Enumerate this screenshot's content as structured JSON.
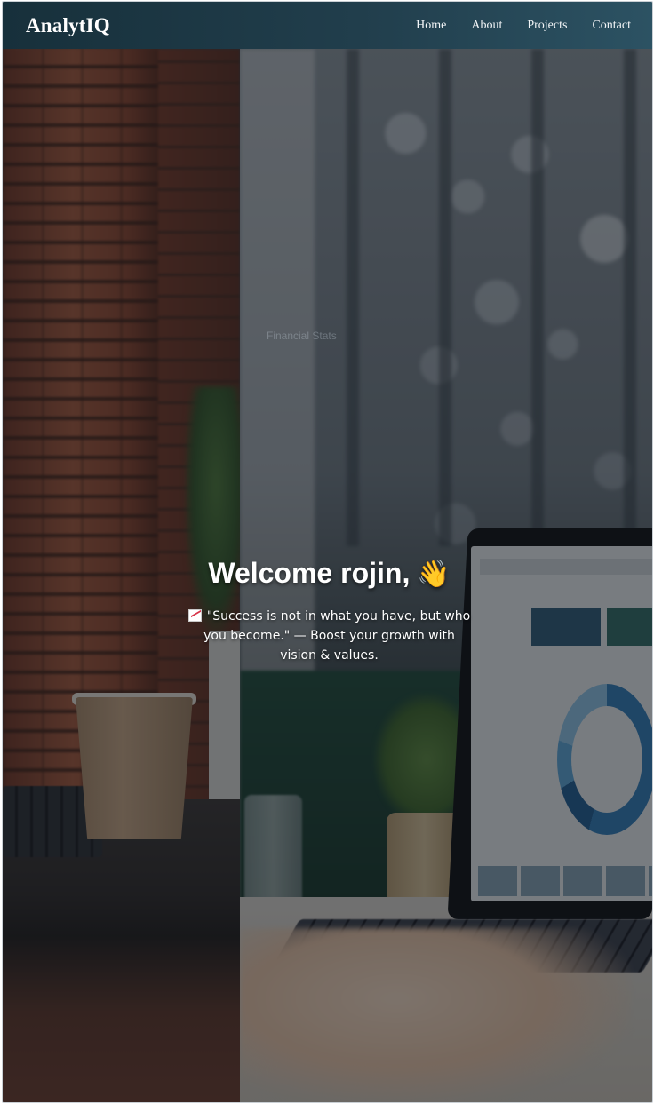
{
  "brand": "AnalytIQ",
  "nav": {
    "items": [
      {
        "label": "Home"
      },
      {
        "label": "About"
      },
      {
        "label": "Projects"
      },
      {
        "label": "Contact"
      }
    ]
  },
  "hero": {
    "welcome": "Welcome rojin,",
    "wave_emoji": "👋",
    "quote": "\"Success is not in what you have, but who you become.\" — Boost your growth with vision & values.",
    "quote_icon": "chart-increasing-icon",
    "background_hint": "Financial Stats"
  },
  "colors": {
    "navbar_start": "#17303b",
    "navbar_end": "#2c5263",
    "text": "#ffffff"
  }
}
